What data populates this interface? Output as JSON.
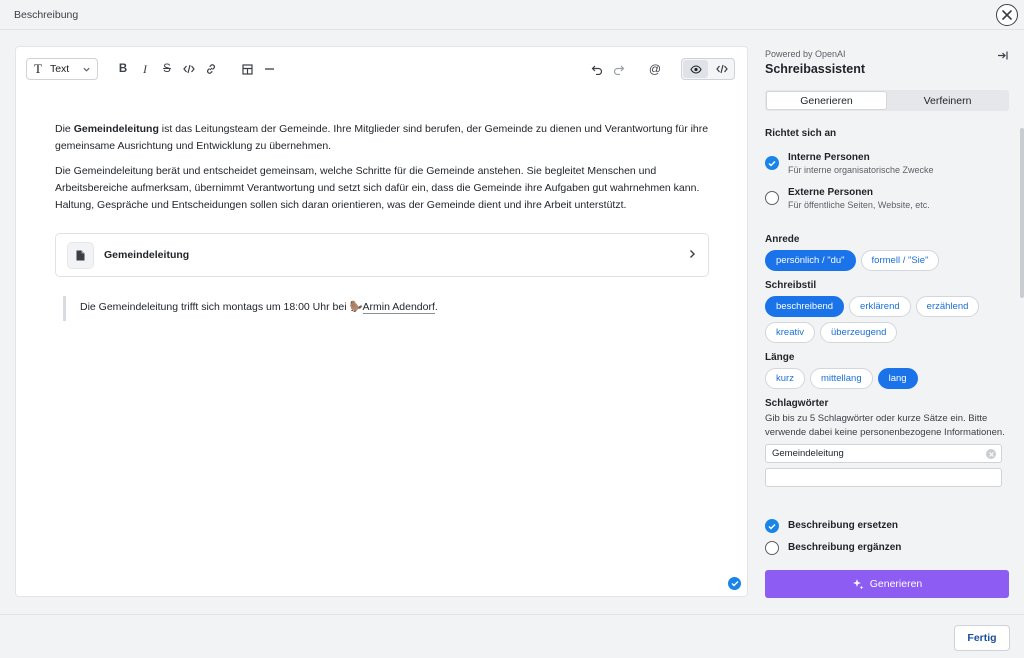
{
  "window": {
    "title": "Beschreibung"
  },
  "toolbar": {
    "block_type": "Text"
  },
  "editor": {
    "para1_bold": "Gemeindeleitung",
    "para1_rest": " ist das Leitungsteam der Gemeinde. Ihre Mitglieder sind berufen, der Gemeinde zu dienen und Verantwortung für ihre gemeinsame Ausrichtung und Entwicklung zu übernehmen.",
    "para2": "Die Gemeindeleitung berät und entscheidet gemeinsam, welche Schritte für die Gemeinde anstehen. Sie begleitet Menschen und Arbeitsbereiche aufmerksam, übernimmt Verantwortung und setzt sich dafür ein, dass die Gemeinde ihre Aufgaben gut wahrnehmen kann. Haltung, Gespräche und Entscheidungen sollen sich daran orientieren, was der Gemeinde dient und ihre Arbeit unterstützt.",
    "card_label": "Gemeindeleitung",
    "quote_text": "Die Gemeindeleitung trifft sich montags um 18:00 Uhr bei",
    "mention_emoji": "🦫",
    "mention_name": "Armin Adendorf",
    "quote_end": "."
  },
  "assistant": {
    "powered_by": "Powered by OpenAI",
    "title": "Schreibassistent",
    "tabs": [
      {
        "label": "Generieren",
        "active": true
      },
      {
        "label": "Verfeinern",
        "active": false
      }
    ],
    "audience": {
      "label": "Richtet sich an",
      "options": [
        {
          "title": "Interne Personen",
          "desc": "Für interne organisatorische Zwecke",
          "selected": true
        },
        {
          "title": "Externe Personen",
          "desc": "Für öffentliche Seiten, Website, etc.",
          "selected": false
        }
      ]
    },
    "salutation": {
      "label": "Anrede",
      "chips": [
        {
          "label": "persönlich / \"du\"",
          "selected": true
        },
        {
          "label": "formell / \"Sie\"",
          "selected": false
        }
      ]
    },
    "style": {
      "label": "Schreibstil",
      "chips": [
        {
          "label": "beschreibend",
          "selected": true
        },
        {
          "label": "erklärend",
          "selected": false
        },
        {
          "label": "erzählend",
          "selected": false
        },
        {
          "label": "kreativ",
          "selected": false
        },
        {
          "label": "überzeugend",
          "selected": false
        }
      ]
    },
    "length": {
      "label": "Länge",
      "chips": [
        {
          "label": "kurz",
          "selected": false
        },
        {
          "label": "mittellang",
          "selected": false
        },
        {
          "label": "lang",
          "selected": true
        }
      ]
    },
    "keywords": {
      "label": "Schlagwörter",
      "hint": "Gib bis zu 5 Schlagwörter oder kurze Sätze ein. Bitte verwende dabei keine personenbezogene Informationen.",
      "value1": "Gemeindeleitung"
    },
    "mode": [
      {
        "label": "Beschreibung ersetzen",
        "selected": true
      },
      {
        "label": "Beschreibung ergänzen",
        "selected": false
      }
    ],
    "generate_label": "Generieren"
  },
  "footer": {
    "done_label": "Fertig"
  },
  "colors": {
    "accent_blue": "#1a73e8",
    "generate_purple": "#8c5cf3"
  }
}
